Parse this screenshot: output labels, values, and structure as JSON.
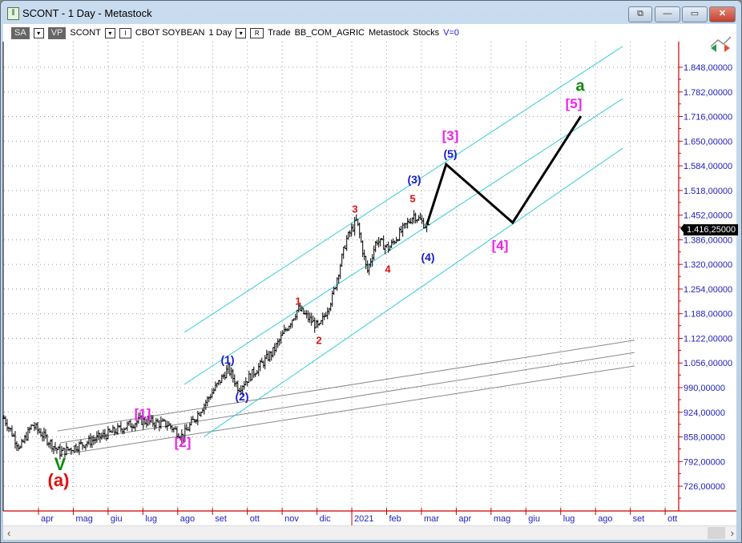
{
  "window": {
    "title": "SCONT - 1 Day - Metastock",
    "buttons": [
      "⧉",
      "—",
      "▭",
      "✕"
    ]
  },
  "toolbar": {
    "sa": "SA",
    "vp": "VP",
    "symbol": "SCONT",
    "i_btn": "I",
    "name": "CBOT SOYBEAN",
    "period": "1 Day",
    "r_btn": "R",
    "trade": "Trade",
    "group": "BB_COM_AGRIC",
    "source": "Metastock",
    "type": "Stocks",
    "volume": "V=0"
  },
  "colors": {
    "axis": "#cc0000",
    "axis_text": "#2020c0",
    "channel": "#33ccdd",
    "trend": "#888888",
    "bars": "#000000"
  },
  "chart_data": {
    "type": "ohlc",
    "title": "SCONT - CBOT SOYBEAN - 1 Day",
    "x_unit": "months since Apr 2020",
    "xlim": [
      -1.05,
      17.6
    ],
    "ylim": [
      690,
      1900
    ],
    "x_ticks": [
      "apr",
      "mag",
      "giu",
      "lug",
      "ago",
      "set",
      "ott",
      "nov",
      "dic",
      "2021",
      "feb",
      "mar",
      "apr",
      "mag",
      "giu",
      "lug",
      "ago",
      "set",
      "ott"
    ],
    "y_ticks": [
      "1.848,00000",
      "1.782,00000",
      "1.716,00000",
      "1.650,00000",
      "1.584,00000",
      "1.518,00000",
      "1.452,00000",
      "1.386,00000",
      "1.320,00000",
      "1.254,00000",
      "1.188,00000",
      "1.122,00000",
      "1.056,00000",
      "990,00000",
      "924,00000",
      "858,00000",
      "792,00000",
      "726,00000"
    ],
    "y_tick_values": [
      1848,
      1782,
      1716,
      1650,
      1584,
      1518,
      1452,
      1386,
      1320,
      1254,
      1188,
      1122,
      1056,
      990,
      924,
      858,
      792,
      726
    ],
    "last_price": "1.416,25000",
    "price_path": [
      [
        -0.99,
        908
      ],
      [
        -0.53,
        827
      ],
      [
        -0.18,
        891
      ],
      [
        0.62,
        816
      ],
      [
        1.66,
        853
      ],
      [
        2.92,
        902
      ],
      [
        3.73,
        891
      ],
      [
        4.14,
        859
      ],
      [
        4.76,
        945
      ],
      [
        5.45,
        1041
      ],
      [
        5.75,
        988
      ],
      [
        6.72,
        1084
      ],
      [
        7.46,
        1202
      ],
      [
        8.06,
        1149
      ],
      [
        8.45,
        1235
      ],
      [
        8.84,
        1385
      ],
      [
        9.14,
        1438
      ],
      [
        9.44,
        1299
      ],
      [
        9.71,
        1385
      ],
      [
        10.06,
        1363
      ],
      [
        10.4,
        1406
      ],
      [
        10.79,
        1453
      ],
      [
        11.21,
        1416.25
      ]
    ],
    "projection": [
      [
        11.16,
        1428
      ],
      [
        11.71,
        1588
      ],
      [
        13.62,
        1432
      ],
      [
        15.58,
        1717
      ]
    ],
    "channel_lines": [
      [
        [
          4.19,
          1138
        ],
        [
          16.78,
          1904
        ]
      ],
      [
        [
          4.19,
          999
        ],
        [
          16.78,
          1764
        ]
      ],
      [
        [
          4.76,
          859
        ],
        [
          16.78,
          1631
        ]
      ]
    ],
    "trend_lines": [
      [
        [
          0.55,
          874
        ],
        [
          17.12,
          1117
        ]
      ],
      [
        [
          0.62,
          842
        ],
        [
          17.12,
          1084
        ]
      ],
      [
        [
          0.62,
          810
        ],
        [
          17.12,
          1048
        ]
      ]
    ],
    "wave_labels": [
      {
        "text": "[1]",
        "color": "#ee22ee"
      },
      {
        "text": "[2]",
        "color": "#ee22ee"
      },
      {
        "text": "V",
        "color": "#118811"
      },
      {
        "text": "(a)",
        "color": "#dd1111"
      },
      {
        "text": "(1)",
        "color": "#1a1ad0"
      },
      {
        "text": "(2)",
        "color": "#1a1ad0"
      },
      {
        "text": "1",
        "color": "#dd1111"
      },
      {
        "text": "2",
        "color": "#dd1111"
      },
      {
        "text": "3",
        "color": "#dd1111"
      },
      {
        "text": "4",
        "color": "#dd1111"
      },
      {
        "text": "5",
        "color": "#dd1111"
      },
      {
        "text": "(3)",
        "color": "#1a1ad0"
      },
      {
        "text": "(4)",
        "color": "#1a1ad0"
      },
      {
        "text": "[3]",
        "color": "#ee22ee"
      },
      {
        "text": "(5)",
        "color": "#1a1ad0"
      },
      {
        "text": "[4]",
        "color": "#ee22ee"
      },
      {
        "text": "[5]",
        "color": "#ee22ee"
      },
      {
        "text": "a",
        "color": "#118811"
      }
    ]
  }
}
